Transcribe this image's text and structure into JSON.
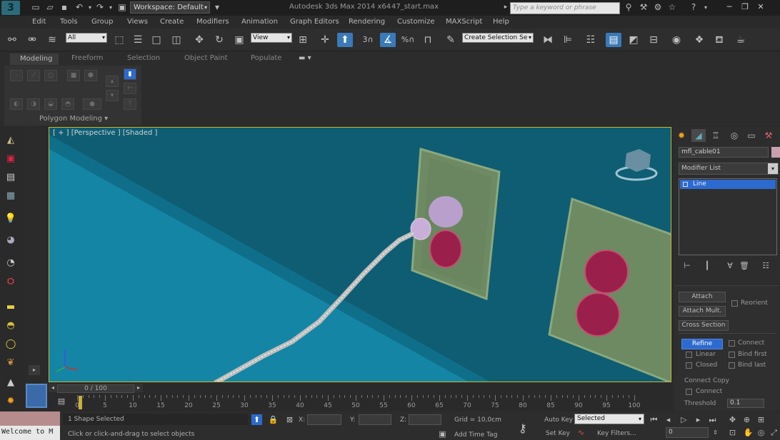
{
  "titlebar": {
    "workspace": "Workspace: Default",
    "app_title": "Autodesk 3ds Max  2014 x64",
    "file_name": "47_start.max",
    "search_placeholder": "Type a keyword or phrase"
  },
  "menu": [
    "Edit",
    "Tools",
    "Group",
    "Views",
    "Create",
    "Modifiers",
    "Animation",
    "Graph Editors",
    "Rendering",
    "Customize",
    "MAXScript",
    "Help"
  ],
  "toolbar": {
    "selection_filter": "All",
    "ref_coord": "View",
    "named_selection": "Create Selection Se",
    "snap_label": "3",
    "percent_label": "%"
  },
  "ribbon": {
    "tabs": [
      "Modeling",
      "Freeform",
      "Selection",
      "Object Paint",
      "Populate"
    ],
    "panel_label": "Polygon Modeling"
  },
  "viewport": {
    "label": "[ + ] [Perspective ] [Shaded ]"
  },
  "command_panel": {
    "object_name": "mfl_cable01",
    "modifier_list": "Modifier List",
    "stack_item": "Line",
    "buttons": {
      "attach": "Attach",
      "attach_mult": "Attach Mult.",
      "cross_section": "Cross Section",
      "refine": "Refine"
    },
    "checks": {
      "reorient": "Reorient",
      "connect": "Connect",
      "linear": "Linear",
      "bind_first": "Bind first",
      "closed": "Closed",
      "bind_last": "Bind last",
      "connect_copy": "Connect Copy",
      "connect2": "Connect",
      "threshold": "Threshold",
      "threshold_value": "0.1"
    }
  },
  "timeline": {
    "slider": "0 / 100",
    "ticks": [
      "0",
      "5",
      "10",
      "15",
      "20",
      "25",
      "30",
      "35",
      "40",
      "45",
      "50",
      "55",
      "60",
      "65",
      "70",
      "75",
      "80",
      "85",
      "90",
      "95",
      "100"
    ]
  },
  "statusbar": {
    "selected": "1 Shape Selected",
    "prompt": "Click or click-and-drag to select objects",
    "listener": "Welcome to M",
    "x_label": "X:",
    "y_label": "Y:",
    "z_label": "Z:",
    "grid": "Grid = 10,0cm",
    "add_time_tag": "Add Time Tag",
    "auto_key": "Auto Key",
    "set_key": "Set Key",
    "selected_combo": "Selected",
    "key_filters": "Key Filters...",
    "frame": "0"
  },
  "colors": {
    "viewport_bg": "#0f5d72",
    "highlight": "#2d6ad0",
    "outlet_green": "#6d8a63",
    "outlet_red": "#9a1f4a"
  }
}
